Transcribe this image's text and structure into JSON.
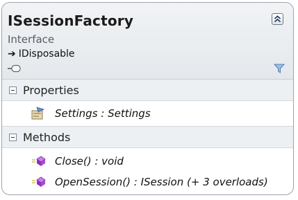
{
  "class": {
    "name": "ISessionFactory",
    "kind": "Interface",
    "inherits": "IDisposable"
  },
  "sections": {
    "properties": {
      "label": "Properties",
      "items": [
        {
          "text": "Settings : Settings",
          "icon": "property-icon"
        }
      ]
    },
    "methods": {
      "label": "Methods",
      "items": [
        {
          "text": "Close() : void",
          "icon": "method-icon"
        },
        {
          "text": "OpenSession() : ISession (+ 3 overloads)",
          "icon": "method-icon"
        }
      ]
    }
  },
  "icons": {
    "collapse": "double-chevron-up-icon",
    "filter": "filter-funnel-icon",
    "interface": "lollipop-interface-icon",
    "inherit": "arrow-right-icon"
  },
  "colors": {
    "header_bg": "#e4e8ec",
    "section_bg": "#edf0f3",
    "border": "#9aa3ac",
    "method_icon": "#a23bc7",
    "filter_icon": "#5b8fc7"
  }
}
